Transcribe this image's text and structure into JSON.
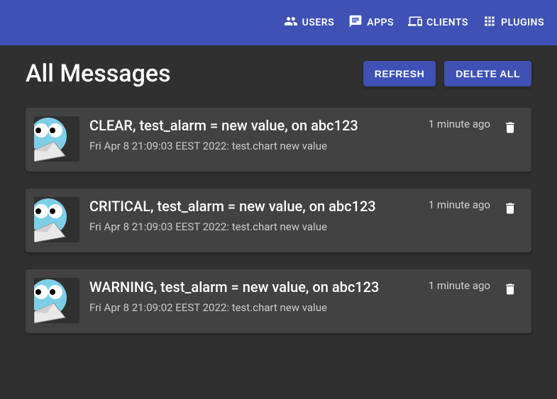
{
  "nav": {
    "users": "USERS",
    "apps": "APPS",
    "clients": "CLIENTS",
    "plugins": "PLUGINS"
  },
  "header": {
    "title": "All Messages",
    "refresh": "REFRESH",
    "delete_all": "DELETE ALL"
  },
  "messages": [
    {
      "title": "CLEAR, test_alarm = new value, on abc123",
      "time": "1 minute ago",
      "subtitle": "Fri Apr  8 21:09:03 EEST 2022: test.chart new value"
    },
    {
      "title": "CRITICAL, test_alarm = new value, on abc123",
      "time": "1 minute ago",
      "subtitle": "Fri Apr  8 21:09:03 EEST 2022: test.chart new value"
    },
    {
      "title": "WARNING, test_alarm = new value, on abc123",
      "time": "1 minute ago",
      "subtitle": "Fri Apr  8 21:09:02 EEST 2022: test.chart new value"
    }
  ]
}
